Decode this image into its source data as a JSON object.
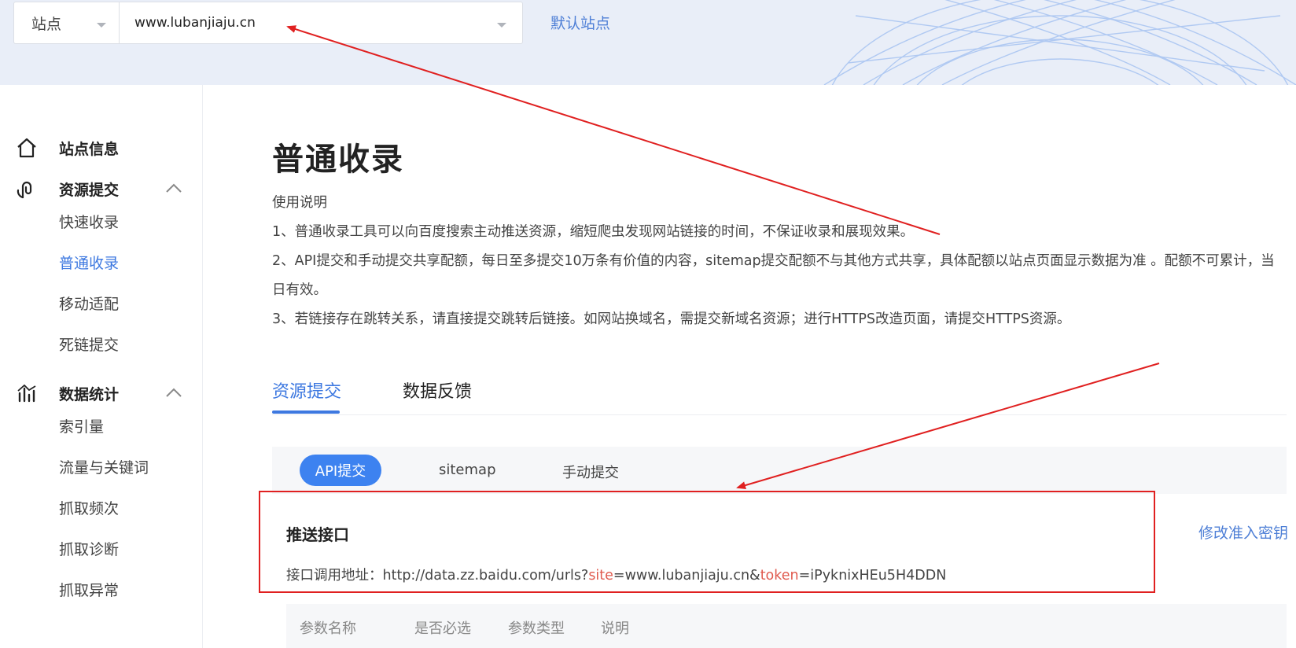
{
  "header": {
    "site_type": "站点",
    "site_url": "www.lubanjiaju.cn",
    "default_site": "默认站点"
  },
  "sidebar": {
    "groups": [
      {
        "label": "站点信息",
        "icon": "home-icon"
      },
      {
        "label": "资源提交",
        "icon": "submit-icon",
        "items": [
          "快速收录",
          "普通收录",
          "移动适配",
          "死链提交"
        ],
        "active_item": "普通收录"
      },
      {
        "label": "数据统计",
        "icon": "stats-icon",
        "items": [
          "索引量",
          "流量与关键词",
          "抓取频次",
          "抓取诊断",
          "抓取异常"
        ]
      }
    ]
  },
  "main": {
    "title": "普通收录",
    "usage_title": "使用说明",
    "usage_lines": [
      "1、普通收录工具可以向百度搜索主动推送资源，缩短爬虫发现网站链接的时间，不保证收录和展现效果。",
      "2、API提交和手动提交共享配额，每日至多提交10万条有价值的内容，sitemap提交配额不与其他方式共享，具体配额以站点页面显示数据为准 。配额不可累计，当日有效。",
      "3、若链接存在跳转关系，请直接提交跳转后链接。如网站换域名，需提交新域名资源；进行HTTPS改造页面，请提交HTTPS资源。"
    ],
    "tabs": [
      "资源提交",
      "数据反馈"
    ],
    "active_tab": "资源提交",
    "subtabs": [
      "API提交",
      "sitemap",
      "手动提交"
    ],
    "active_subtab": "API提交",
    "push_title": "推送接口",
    "modify_key": "修改准入密钥",
    "api": {
      "label": "接口调用地址：",
      "prefix": "http://data.zz.baidu.com/urls?",
      "site_key": "site",
      "site_value": "=www.lubanjiaju.cn&",
      "token_key": "token",
      "token_value": "=iPyknixHEu5H4DDN"
    },
    "param_headers": [
      "参数名称",
      "是否必选",
      "参数类型",
      "说明"
    ]
  },
  "colors": {
    "accent": "#3d78e0",
    "annotation": "#e02020",
    "highlight": "#e05a4e"
  }
}
